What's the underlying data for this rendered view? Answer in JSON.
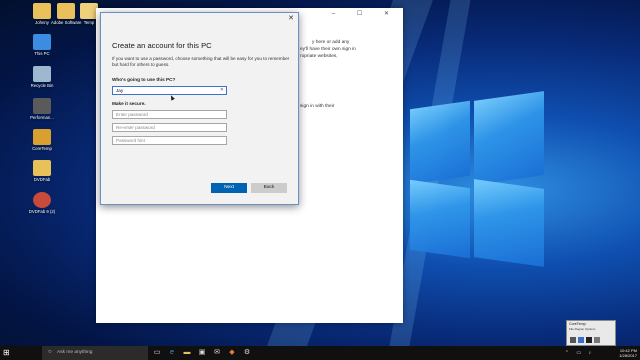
{
  "desktop": {
    "icons": [
      {
        "label": "Johnny"
      },
      {
        "label": "Adobe Software"
      },
      {
        "label": "Temp"
      },
      {
        "label": "This PC"
      },
      {
        "label": "Recycle Bin"
      },
      {
        "label": "Performan..."
      },
      {
        "label": "CoreTemp"
      },
      {
        "label": "DVDFab"
      },
      {
        "label": "DVDFab 9 (2)"
      }
    ],
    "accent_color": "#0f4fb0"
  },
  "settings_window": {
    "title": "Settings",
    "controls": "–  ☐  ✕",
    "peek_lines": [
      "y here or add any",
      "ey'll have their own sign in",
      "ropriate websites,",
      "sign in with their"
    ]
  },
  "dialog": {
    "close_glyph": "✕",
    "title": "Create an account for this PC",
    "description": "If you want to use a password, choose something that will be easy for you to remember but hard for others to guess.",
    "who_label": "Who's going to use this PC?",
    "username_value": "Jay",
    "clear_glyph": "✕",
    "secure_label": "Make it secure.",
    "password_placeholder": "Enter password",
    "reenter_placeholder": "Re-enter password",
    "hint_placeholder": "Password hint",
    "next_label": "Next",
    "back_label": "Back",
    "primary_color": "#0063b1"
  },
  "mini_window": {
    "title": "CoreTemp",
    "menu": "File  Region  Options"
  },
  "taskbar": {
    "start_glyph": "⊞",
    "search_glyph": "○",
    "search_placeholder": "Ask me anything",
    "apps": [
      {
        "icon": "task-view-icon",
        "glyph": "▭"
      },
      {
        "icon": "edge-icon",
        "glyph": "e"
      },
      {
        "icon": "file-explorer-icon",
        "glyph": "▬"
      },
      {
        "icon": "store-icon",
        "glyph": "▣"
      },
      {
        "icon": "mail-icon",
        "glyph": "✉"
      },
      {
        "icon": "app-icon",
        "glyph": "◆"
      },
      {
        "icon": "settings-icon",
        "glyph": "⚙"
      }
    ],
    "tray_glyphs": "⌃ ▭ ♪",
    "time": "10:42 PM",
    "date": "1/28/2017"
  }
}
